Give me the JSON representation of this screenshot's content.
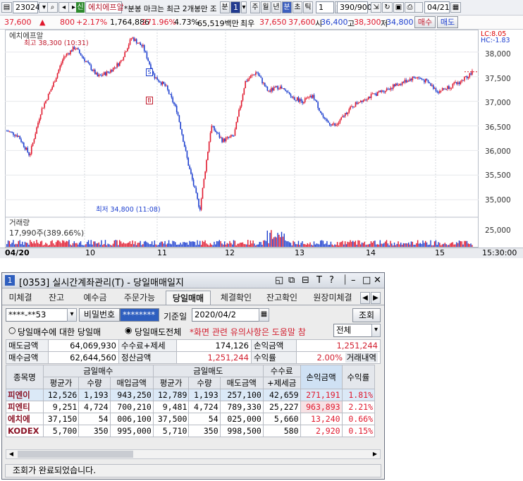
{
  "toolbar": {
    "code": "23024",
    "stock_badge": "신",
    "stock_name": "에치에프알",
    "notice": "*분봉 마크는 최근 2개봉만 조",
    "period_options": [
      "분",
      "1",
      "주",
      "월",
      "년",
      "분",
      "초",
      "틱"
    ],
    "interval": "1",
    "count_display": "390/900",
    "date_field": "04/21"
  },
  "quote": {
    "price": "37,600",
    "arrow": "▲",
    "change": "800",
    "change_pct": "+2.17%",
    "volume": "1,764,886",
    "vol_ratio": "271.96%",
    "turnover_pct": "4.73%",
    "amount": "65,519백만",
    "open_label": "최우",
    "open": "37,650",
    "price2": "37,600",
    "high_label": "시",
    "high": "36,400",
    "low_label": "고",
    "low": "38,300",
    "close_label": "저",
    "close": "34,800",
    "buy_label": "매수",
    "sell_label": "매도"
  },
  "chart": {
    "series_label": "에치에프알",
    "high_note": "최고 38,300 (10:31)",
    "low_note": "최저 34,800 (11:08)",
    "lc_label": "LC:8.05",
    "hc_label": "HC:-1.83",
    "volume_label": "거래량",
    "volume_value": "17,990주(389.66%)",
    "s_marker": "S",
    "b_marker": "B",
    "y_ticks": [
      "38,000",
      "37,500",
      "37,000",
      "36,500",
      "36,000",
      "35,500",
      "35,000"
    ],
    "vol_tick": "25,000",
    "x_labels": [
      "04/20",
      "10",
      "11",
      "12",
      "13",
      "14",
      "15",
      "15:30:00"
    ]
  },
  "chart_data": {
    "type": "candlestick",
    "title": "에치에프알",
    "ylim": [
      34700,
      38400
    ],
    "x": [
      "09:00",
      "10:00",
      "11:00",
      "12:00",
      "13:00",
      "14:00",
      "15:00",
      "15:30"
    ],
    "series": [
      {
        "name": "에치에프알",
        "values": [
          36400,
          36300,
          35900,
          36800,
          37300,
          37900,
          38100,
          37800,
          37500,
          37600,
          37800,
          38300,
          38100,
          37500,
          37300,
          36800,
          35700,
          34800,
          36500,
          36200,
          36300,
          37400,
          37600,
          37200,
          37300,
          37100,
          37000,
          37100,
          36600,
          36500,
          36800,
          37000,
          37100,
          37200,
          37300,
          37400,
          37500,
          37400,
          37200,
          37300,
          37400,
          37600
        ]
      }
    ],
    "annotations": [
      "최고 38,300 (10:31)",
      "최저 34,800 (11:08)"
    ],
    "volume_label": "17,990주(389.66%)"
  },
  "window": {
    "number": "1",
    "title": "[0353] 실시간계좌관리(T) - 당일매매일지",
    "tabs": [
      "미체결",
      "잔고",
      "예수금",
      "주문가능",
      "당일매매",
      "체결확인",
      "잔고확인",
      "원장미체결"
    ],
    "active_tab": "당일매매",
    "account": "****-**53",
    "password_label": "비밀번호",
    "password": "********",
    "base_date_label": "기준일",
    "base_date": "2020/04/2",
    "query_button": "조회",
    "radio1": "당일매수에 대한 당일매",
    "radio2": "당일매도전체",
    "warning": "*화면 관련 유의사항은 도움말 참",
    "filter": "전체",
    "summary": {
      "sell_amount_label": "매도금액",
      "sell_amount": "64,069,930",
      "fee_label": "수수료+제세",
      "fee": "174,126",
      "pnl_label": "손익금액",
      "pnl": "1,251,244",
      "buy_amount_label": "매수금액",
      "buy_amount": "62,644,560",
      "settle_label": "정산금액",
      "settle": "1,251,244",
      "rate_label": "수익률",
      "rate": "2.00%",
      "history_label": "거래내역"
    },
    "table_headers": {
      "name": "종목명",
      "buy_group": "금일매수",
      "sell_group": "금일매도",
      "fee": "수수료",
      "fee2": "+제세금",
      "pnl": "손익금액",
      "rate": "수익률",
      "avg": "평균가",
      "qty": "수량",
      "buy_amt": "매입금액",
      "sell_amt": "매도금액"
    },
    "rows": [
      {
        "name": "피엔이",
        "buy_avg": "12,526",
        "buy_qty": "1,193",
        "buy_amt": "943,250",
        "sell_avg": "12,789",
        "sell_qty": "1,193",
        "sell_amt": "257,100",
        "fee": "42,659",
        "pnl": "271,191",
        "rate": "1.81%"
      },
      {
        "name": "피엔티",
        "buy_avg": "9,251",
        "buy_qty": "4,724",
        "buy_amt": "700,210",
        "sell_avg": "9,481",
        "sell_qty": "4,724",
        "sell_amt": "789,330",
        "fee": "25,227",
        "pnl": "963,893",
        "rate": "2.21%"
      },
      {
        "name": "에치에",
        "buy_avg": "37,150",
        "buy_qty": "54",
        "buy_amt": "006,100",
        "sell_avg": "37,500",
        "sell_qty": "54",
        "sell_amt": "025,000",
        "fee": "5,660",
        "pnl": "13,240",
        "rate": "0.66%"
      },
      {
        "name": "KODEX",
        "buy_avg": "5,700",
        "buy_qty": "350",
        "buy_amt": "995,000",
        "sell_avg": "5,710",
        "sell_qty": "350",
        "sell_amt": "998,500",
        "fee": "580",
        "pnl": "2,920",
        "rate": "0.15%"
      }
    ],
    "status": "조회가 완료되었습니다."
  },
  "colors": {
    "up": "#e0182d",
    "down": "#1d3fcf",
    "highlight": "#dbe9f7"
  }
}
